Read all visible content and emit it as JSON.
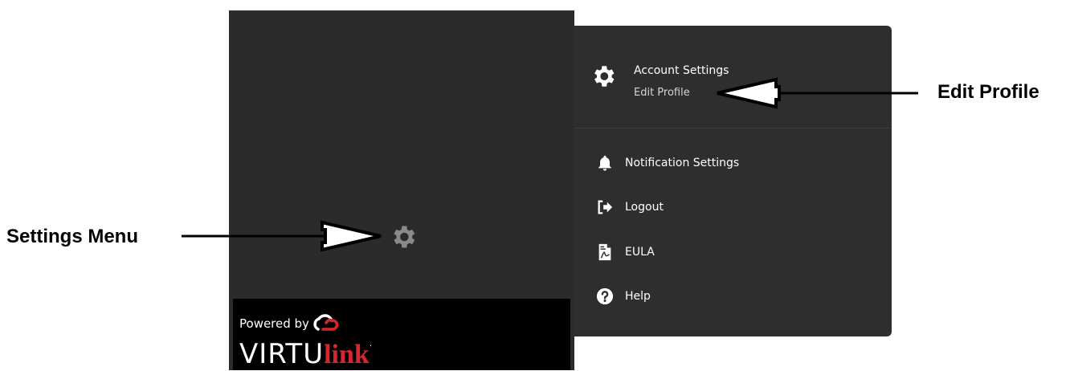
{
  "callouts": {
    "settings_menu": "Settings Menu",
    "edit_profile": "Edit Profile"
  },
  "sidebar": {
    "gear_icon": "gear-icon",
    "brand": {
      "powered_by": "Powered by",
      "wordmark_main": "VIRTU",
      "wordmark_accent": "link",
      "trademark": "·"
    }
  },
  "menu": {
    "header": {
      "icon": "gear-icon",
      "title": "Account Settings",
      "subtitle": "Edit Profile"
    },
    "items": [
      {
        "label": "Notification Settings",
        "icon": "bell-icon"
      },
      {
        "label": "Logout",
        "icon": "logout-icon"
      },
      {
        "label": "EULA",
        "icon": "document-icon"
      },
      {
        "label": "Help",
        "icon": "help-icon"
      }
    ]
  },
  "colors": {
    "sidebar_bg": "#2b2b2b",
    "menu_bg": "#2e2e2e",
    "brand_bg": "#000000",
    "accent_red": "#d9262c",
    "icon_gray": "#8a8a8a"
  }
}
